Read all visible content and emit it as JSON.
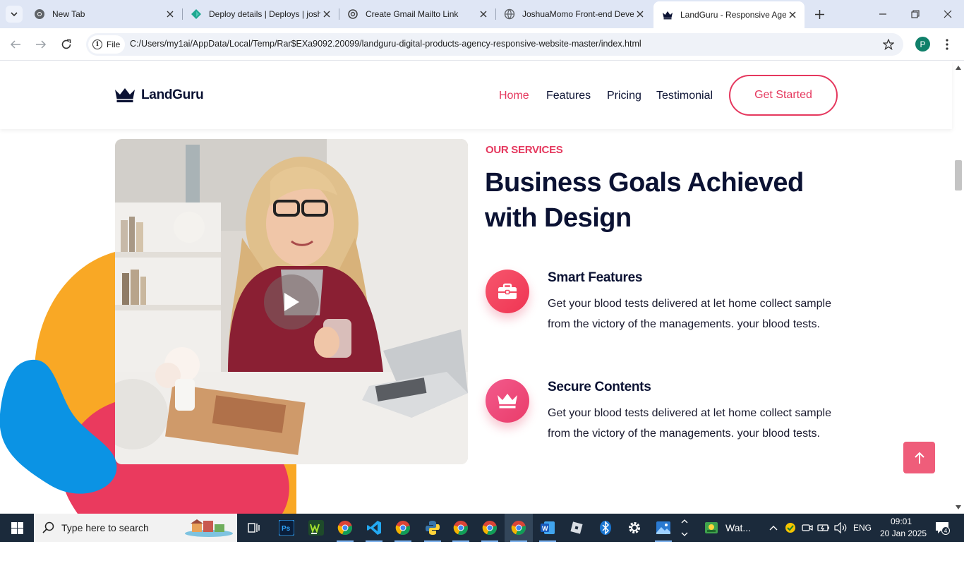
{
  "browser": {
    "tabs": [
      {
        "title": "New Tab",
        "icon": "chrome-icon"
      },
      {
        "title": "Deploy details | Deploys | joshuamomo",
        "icon": "netlify-icon"
      },
      {
        "title": "Create Gmail Mailto Link",
        "icon": "openai-icon"
      },
      {
        "title": "JoshuaMomo Front-end Developer",
        "icon": "globe-icon"
      },
      {
        "title": "LandGuru - Responsive Agency",
        "icon": "crown-icon",
        "active": true
      }
    ],
    "url_chip": "File",
    "url": "C:/Users/my1ai/AppData/Local/Temp/Rar$EXa9092.20099/landguru-digital-products-agency-responsive-website-master/index.html",
    "profile_initial": "P"
  },
  "site": {
    "brand": "LandGuru",
    "nav": [
      "Home",
      "Features",
      "Pricing",
      "Testimonial"
    ],
    "active_nav": "Home",
    "cta": "Get Started",
    "accent": "#e5385e",
    "dark": "#0b1233"
  },
  "section": {
    "eyebrow": "OUR SERVICES",
    "headline_line1": "Business Goals Achieved",
    "headline_line2": "with Design",
    "features": [
      {
        "title": "Smart Features",
        "icon": "briefcase-icon",
        "description": "Get your blood tests delivered at let home collect sample from the victory of the managements. your blood tests."
      },
      {
        "title": "Secure Contents",
        "icon": "crown-icon",
        "description": "Get your blood tests delivered at let home collect sample from the victory of the managements. your blood tests."
      }
    ]
  },
  "taskbar": {
    "search_placeholder": "Type here to search",
    "weather_text": "Wat...",
    "language": "ENG",
    "time": "09:01",
    "date": "20 Jan 2025",
    "notification_count": "4"
  }
}
